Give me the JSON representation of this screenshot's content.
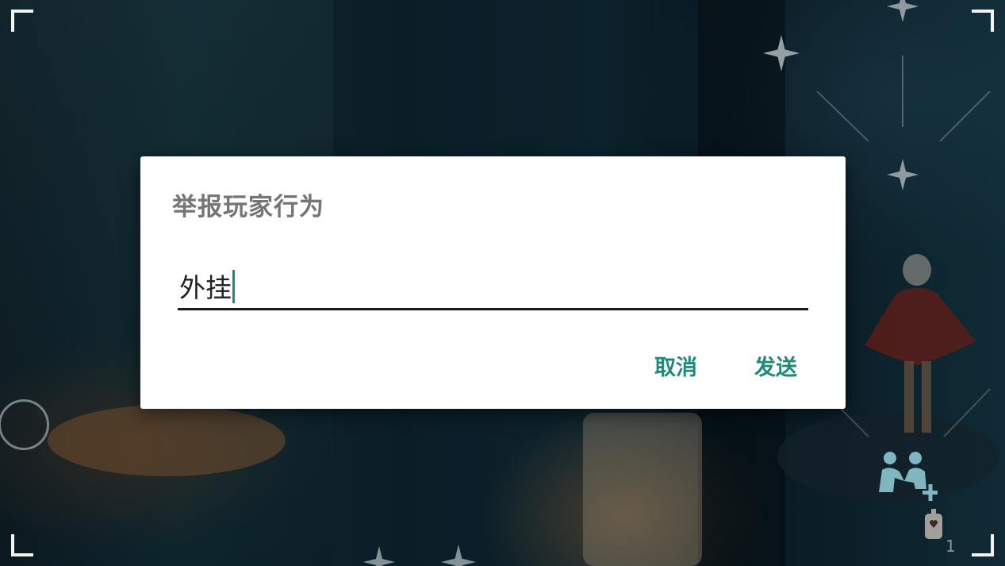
{
  "dialog": {
    "title": "举报玩家行为",
    "input_value": "外挂",
    "cancel_label": "取消",
    "send_label": "发送"
  },
  "hud": {
    "candle_count": "1"
  },
  "colors": {
    "accent": "#1f8a78",
    "title": "#757575",
    "dialog_bg": "#ffffff"
  },
  "icons": [
    "corner-bracket-icon",
    "star-icon",
    "joystick-icon",
    "add-friend-icon",
    "candle-icon"
  ]
}
